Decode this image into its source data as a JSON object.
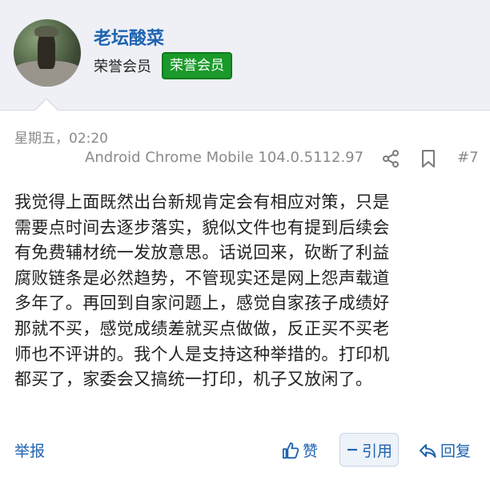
{
  "post": {
    "username": "老坛酸菜",
    "rank_text": "荣誉会员",
    "rank_badge": "荣誉会员",
    "timestamp": "星期五，02:20",
    "device": "Android Chrome Mobile 104.0.5112.97",
    "floor": "#7",
    "content_lines": [
      "我觉得上面既然出台新规肯定会有相应对策，只是",
      "需要点时间去逐步落实，貌似文件也有提到后续会",
      "有免费辅材统一发放意思。话说回来，砍断了利益",
      "腐败链条是必然趋势，不管现实还是网上怨声载道",
      "多年了。再回到自家问题上，感觉自家孩子成绩好",
      "那就不买，感觉成绩差就买点做做，反正买不买老",
      "师也不评讲的。我个人是支持这种举措的。打印机",
      "都买了，家委会又搞统一打印，机子又放闲了。"
    ]
  },
  "actions": {
    "report": "举报",
    "like": "赞",
    "quote": "引用",
    "reply": "回复"
  },
  "colors": {
    "link": "#1e63b0",
    "badge": "#1a9a2a",
    "header_bg": "#eef0f6",
    "meta": "#8a8a8a"
  },
  "icons": {
    "share": "share-icon",
    "bookmark": "bookmark-icon",
    "like": "thumbs-up-icon",
    "quote": "minus-icon",
    "reply": "reply-arrow-icon"
  }
}
